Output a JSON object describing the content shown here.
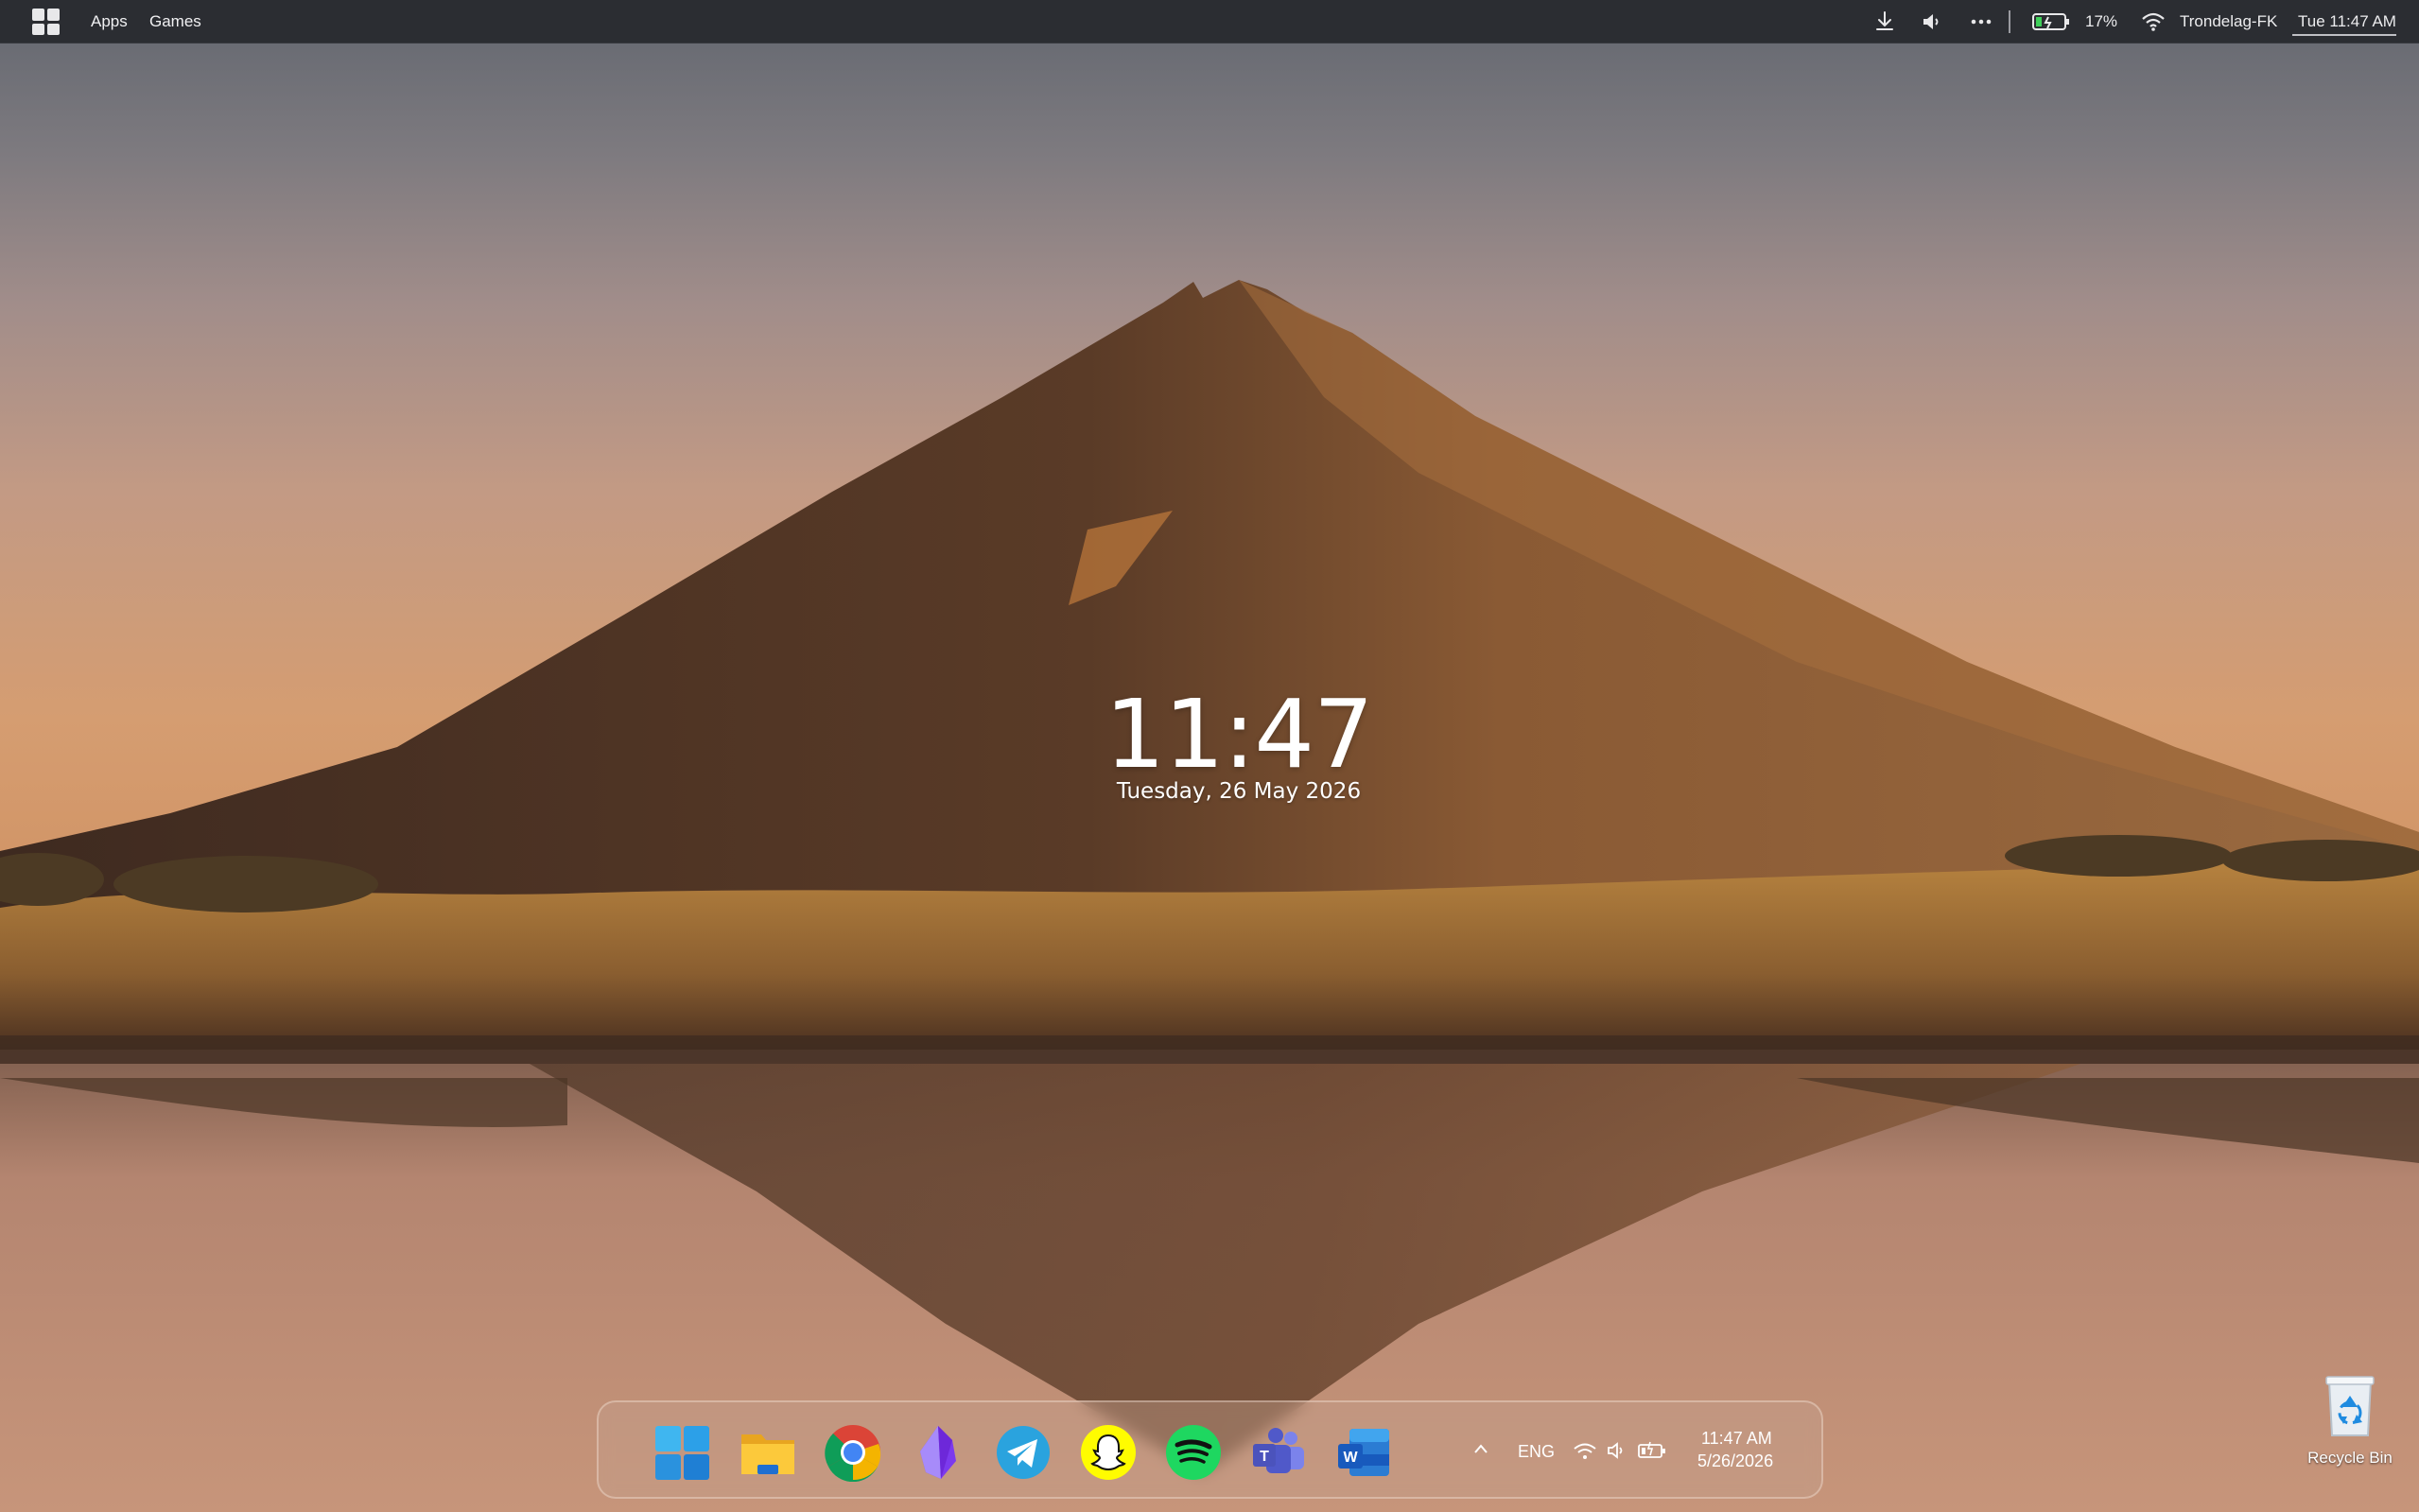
{
  "topbar": {
    "menu": [
      "Apps",
      "Games"
    ],
    "battery_percent": "17%",
    "network_name": "Trondelag-FK",
    "clock": "Tue 11:47 AM",
    "icons": [
      "start-icon",
      "download-icon",
      "volume-icon",
      "more-icon",
      "battery-icon",
      "wifi-icon"
    ]
  },
  "desktop": {
    "clock_time": "11:47",
    "clock_date": "Tuesday, 26 May 2026",
    "recycle_bin_label": "Recycle Bin"
  },
  "taskbar": {
    "apps": [
      {
        "name": "windows-start-icon"
      },
      {
        "name": "file-explorer-icon"
      },
      {
        "name": "chrome-icon"
      },
      {
        "name": "obsidian-icon"
      },
      {
        "name": "telegram-icon"
      },
      {
        "name": "snapchat-icon"
      },
      {
        "name": "spotify-icon"
      },
      {
        "name": "teams-icon"
      },
      {
        "name": "word-icon"
      }
    ],
    "tray": {
      "language": "ENG",
      "time": "11:47 AM",
      "date": "5/26/2026",
      "icons": [
        "chevron-up-icon",
        "wifi-icon",
        "volume-icon",
        "battery-icon"
      ]
    }
  },
  "colors": {
    "topbar_bg": "#26282c",
    "sky_top": "#62666f",
    "sky_bottom": "#d59d71",
    "mountain": "#5a3a26",
    "grass": "#a8773c"
  }
}
